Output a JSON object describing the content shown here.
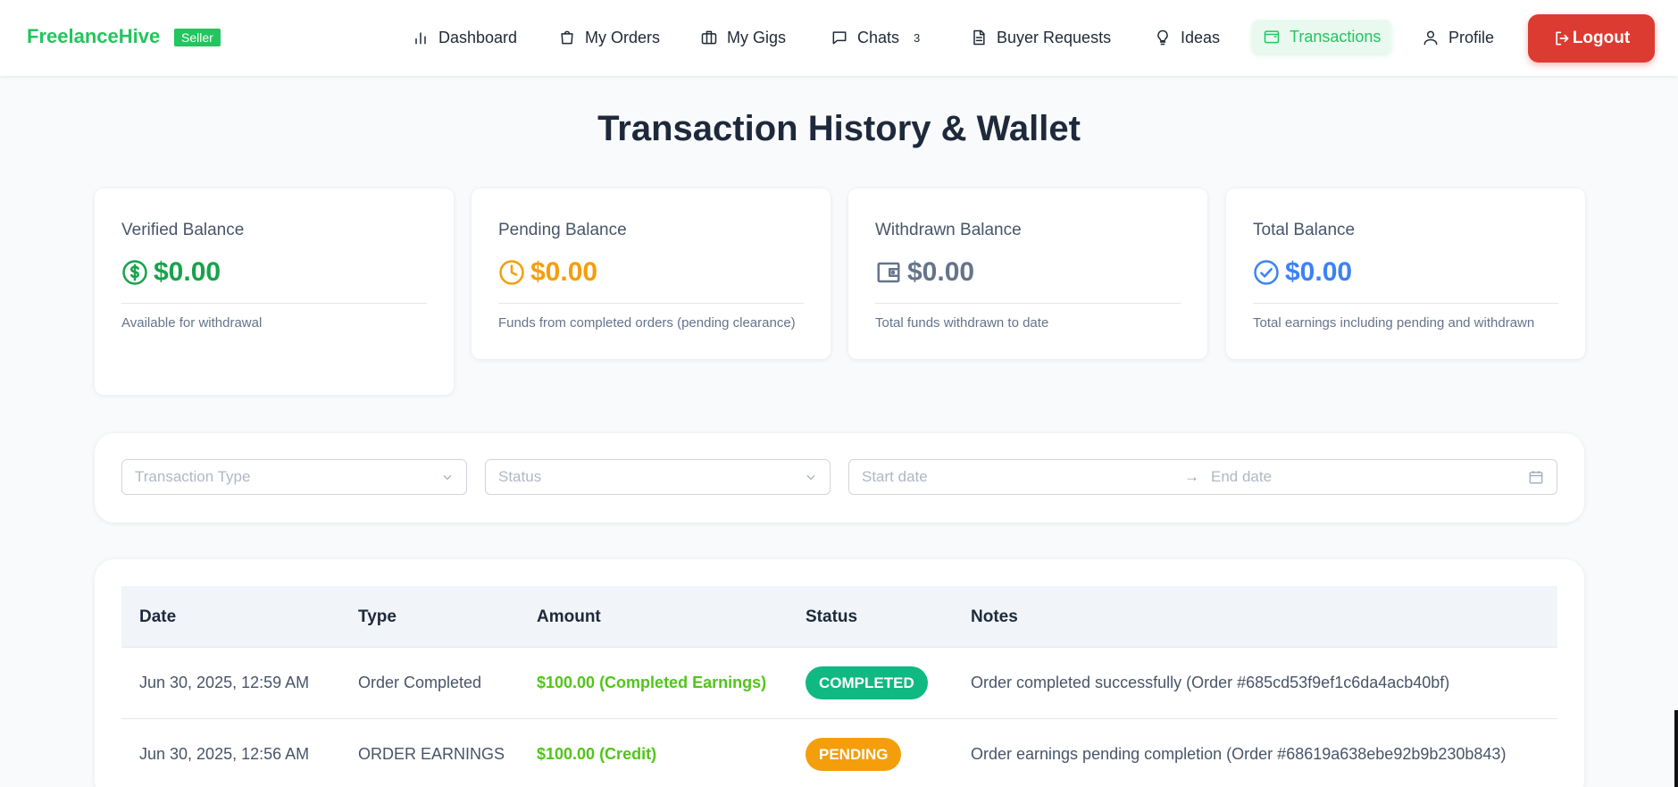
{
  "brand": {
    "name": "FreelanceHive",
    "badge": "Seller"
  },
  "nav": {
    "items": [
      {
        "label": "Dashboard",
        "icon": "bar-chart-icon"
      },
      {
        "label": "My Orders",
        "icon": "shopping-bag-icon"
      },
      {
        "label": "My Gigs",
        "icon": "briefcase-icon"
      },
      {
        "label": "Chats",
        "icon": "message-icon",
        "count": "3"
      },
      {
        "label": "Buyer Requests",
        "icon": "document-icon"
      },
      {
        "label": "Ideas",
        "icon": "lightbulb-icon"
      },
      {
        "label": "Transactions",
        "icon": "wallet-icon",
        "active": true
      },
      {
        "label": "Profile",
        "icon": "user-icon"
      }
    ],
    "logout_label": "Logout"
  },
  "page_title": "Transaction History & Wallet",
  "cards": [
    {
      "label": "Verified Balance",
      "value": "$0.00",
      "desc": "Available for withdrawal",
      "color": "#16a34a",
      "icon": "dollar-circle-icon"
    },
    {
      "label": "Pending Balance",
      "value": "$0.00",
      "desc": "Funds from completed orders (pending clearance)",
      "color": "#f59e0b",
      "icon": "clock-icon"
    },
    {
      "label": "Withdrawn Balance",
      "value": "$0.00",
      "desc": "Total funds withdrawn to date",
      "color": "#64748b",
      "icon": "wallet-icon"
    },
    {
      "label": "Total Balance",
      "value": "$0.00",
      "desc": "Total earnings including pending and withdrawn",
      "color": "#3b82f6",
      "icon": "check-circle-icon"
    }
  ],
  "filters": {
    "type_placeholder": "Transaction Type",
    "status_placeholder": "Status",
    "start_placeholder": "Start date",
    "arrow": "→",
    "end_placeholder": "End date"
  },
  "table": {
    "headers": [
      "Date",
      "Type",
      "Amount",
      "Status",
      "Notes"
    ],
    "rows": [
      {
        "date": "Jun 30, 2025, 12:59 AM",
        "type": "Order Completed",
        "amount": "$100.00 (Completed Earnings)",
        "status": "COMPLETED",
        "status_color": "#10b981",
        "notes": "Order completed successfully (Order #685cd53f9ef1c6da4acb40bf)"
      },
      {
        "date": "Jun 30, 2025, 12:56 AM",
        "type": "ORDER EARNINGS",
        "amount": "$100.00 (Credit)",
        "status": "PENDING",
        "status_color": "#f59e0b",
        "notes": "Order earnings pending completion (Order #68619a638ebe92b9b230b843)"
      }
    ]
  }
}
